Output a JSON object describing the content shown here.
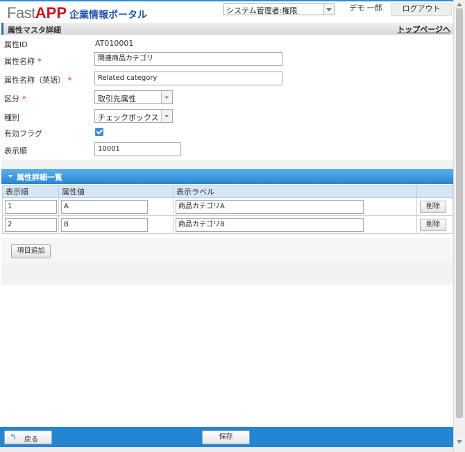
{
  "header": {
    "logo_fast": "Fast",
    "logo_app": "APP",
    "logo_portal": "企業情報ポータル",
    "role_selected": "システム管理者:権限",
    "user_name": "デモ 一郎",
    "logout_label": "ログアウト"
  },
  "titlebar": {
    "title": "属性マスタ詳細",
    "top_link": "トップページへ"
  },
  "form": {
    "attr_id_label": "属性ID",
    "attr_id_value": "AT010001",
    "attr_name_label": "属性名称",
    "attr_name_value": "関連商品カテゴリ",
    "attr_name_en_label": "属性名称（英語）",
    "attr_name_en_value": "Related category",
    "kubun_label": "区分",
    "kubun_value": "取引先属性",
    "shubetsu_label": "種別",
    "shubetsu_value": "チェックボックス",
    "valid_flag_label": "有効フラグ",
    "valid_flag_checked": true,
    "display_order_label": "表示順",
    "display_order_value": "10001",
    "required_mark": "*"
  },
  "detail_panel": {
    "title": "属性詳細一覧",
    "columns": [
      "表示順",
      "属性値",
      "表示ラベル",
      ""
    ],
    "rows": [
      {
        "order": "1",
        "value": "A",
        "label": "商品カテゴリA",
        "delete": "削除"
      },
      {
        "order": "2",
        "value": "B",
        "label": "商品カテゴリB",
        "delete": "削除"
      }
    ],
    "add_button": "項目追加"
  },
  "footer": {
    "back_label": "戻る",
    "back_icon": "↰",
    "save_label": "保存"
  },
  "colors": {
    "accent": "#2585d5",
    "logo_red": "#c8141e",
    "logo_blue": "#1f55a8",
    "required_red": "#d0141e"
  }
}
